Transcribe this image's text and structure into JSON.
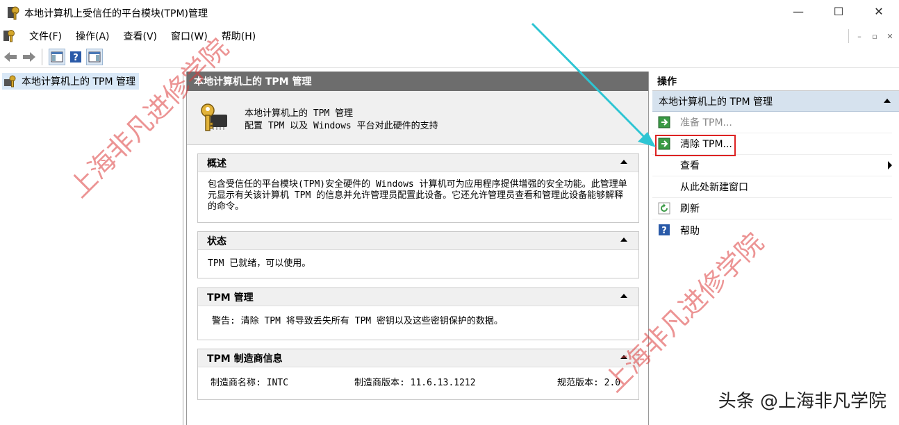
{
  "window": {
    "title": "本地计算机上受信任的平台模块(TPM)管理",
    "minimize": "—",
    "maximize": "☐",
    "close": "✕"
  },
  "menu": {
    "items": [
      "文件(F)",
      "操作(A)",
      "查看(V)",
      "窗口(W)",
      "帮助(H)"
    ]
  },
  "mdi": {
    "minimize": "–",
    "restore": "▫",
    "close": "✕"
  },
  "tree": {
    "root_label": "本地计算机上的 TPM 管理"
  },
  "center": {
    "header": "本地计算机上的 TPM 管理",
    "intro_line1": "本地计算机上的 TPM 管理",
    "intro_line2": "配置 TPM 以及 Windows 平台对此硬件的支持",
    "overview": {
      "title": "概述",
      "body": "包含受信任的平台模块(TPM)安全硬件的 Windows 计算机可为应用程序提供增强的安全功能。此管理单元显示有关该计算机 TPM 的信息并允许管理员配置此设备。它还允许管理员查看和管理此设备能够解释的命令。"
    },
    "status": {
      "title": "状态",
      "body": "TPM 已就绪，可以使用。"
    },
    "tpm_manage": {
      "title": "TPM 管理",
      "body": "警告: 清除 TPM 将导致丢失所有 TPM 密钥以及这些密钥保护的数据。"
    },
    "manufacturer": {
      "title": "TPM 制造商信息",
      "name": "制造商名称: INTC",
      "version": "制造商版本: 11.6.13.1212",
      "spec": "规范版本: 2.0"
    }
  },
  "actions": {
    "header": "操作",
    "group": "本地计算机上的 TPM 管理",
    "items": {
      "prepare": "准备 TPM...",
      "clear": "清除 TPM...",
      "view": "查看",
      "new_window": "从此处新建窗口",
      "refresh": "刷新",
      "help": "帮助"
    }
  },
  "watermark": {
    "text": "上海非凡进修学院"
  },
  "brand": {
    "text": "头条 @上海非凡学院"
  },
  "colors": {
    "highlight": "#dd2222",
    "annotation_arrow": "#2ec5d3",
    "center_header": "#6d6d6d"
  }
}
